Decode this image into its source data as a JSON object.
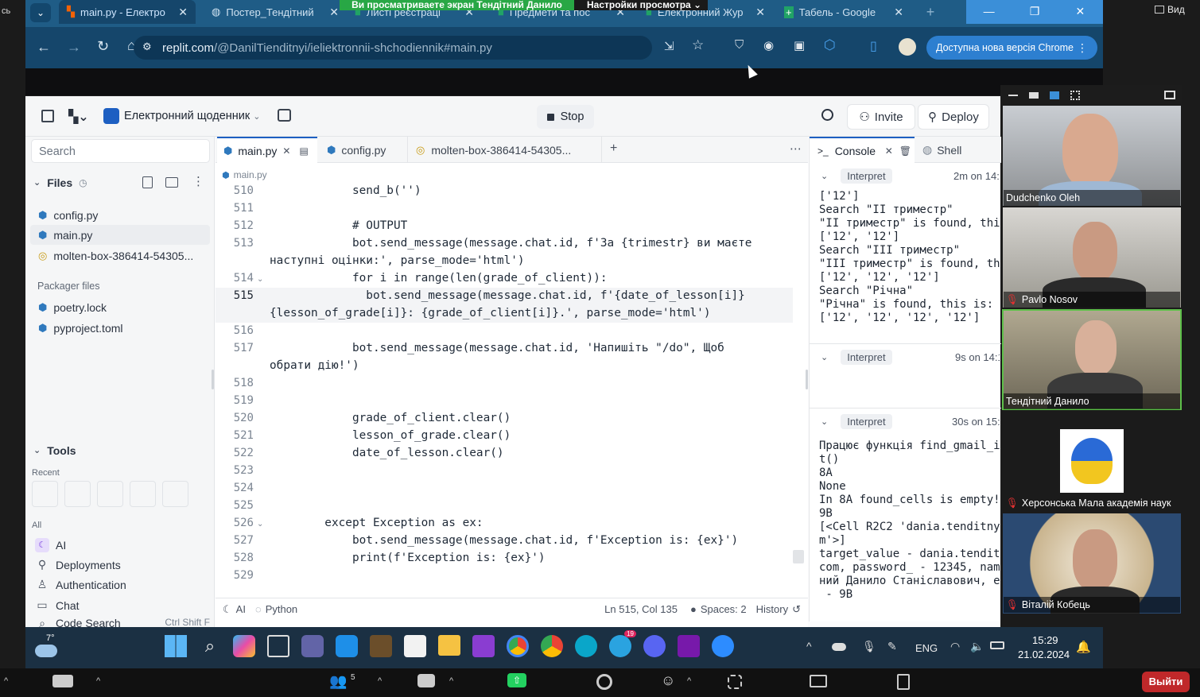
{
  "chrome": {
    "tabs": [
      {
        "label": "main.py - Електро"
      },
      {
        "label": "Постер_Тендітний"
      },
      {
        "label": "Листі реєстраці"
      },
      {
        "label": "Предмети та пос"
      },
      {
        "label": "Електронний Жур"
      },
      {
        "label": "Табель - Google "
      }
    ],
    "url_host": "replit.com",
    "url_path": "/@DanilTienditnyi/ieliektronnii-shchodiennik#main.py",
    "update_button": "Доступна нова версія Chrome",
    "share_banner": "Ви просматриваете экран Тендітний Данило",
    "view_settings": "Настройки просмотра"
  },
  "replit": {
    "project_name": "Електронний щоденник",
    "stop_label": "Stop",
    "invite_label": "Invite",
    "deploy_label": "Deploy",
    "search_placeholder": "Search",
    "files_header": "Files",
    "files": [
      "config.py",
      "main.py",
      "molten-box-386414-54305..."
    ],
    "packager_header": "Packager files",
    "packager_files": [
      "poetry.lock",
      "pyproject.toml"
    ],
    "tools_header": "Tools",
    "recent_label": "Recent",
    "all_label": "All",
    "tools": [
      "AI",
      "Deployments",
      "Authentication",
      "Chat",
      "Code Search"
    ],
    "tools_shortcut": "Ctrl Shift F",
    "editor_tabs": [
      "main.py",
      "config.py",
      "molten-box-386414-54305..."
    ],
    "breadcrumb": "main.py",
    "code_lines": [
      {
        "n": "510",
        "text": "            send_b('')"
      },
      {
        "n": "511",
        "text": ""
      },
      {
        "n": "512",
        "text": "            # OUTPUT"
      },
      {
        "n": "513",
        "text": "            bot.send_message(message.chat.id, f'За {trimestr} ви маєте"
      },
      {
        "n": "",
        "text": "наступні оцінки:', parse_mode='html')"
      },
      {
        "n": "514",
        "text": "            for i in range(len(grade_of_client)):"
      },
      {
        "n": "515",
        "text": "              bot.send_message(message.chat.id, f'{date_of_lesson[i]}"
      },
      {
        "n": "",
        "text": "{lesson_of_grade[i]}: {grade_of_client[i]}.', parse_mode='html')"
      },
      {
        "n": "516",
        "text": ""
      },
      {
        "n": "517",
        "text": "            bot.send_message(message.chat.id, 'Напишіть \"/do\", Щоб"
      },
      {
        "n": "",
        "text": "обрати дію!')"
      },
      {
        "n": "518",
        "text": ""
      },
      {
        "n": "519",
        "text": ""
      },
      {
        "n": "520",
        "text": "            grade_of_client.clear()"
      },
      {
        "n": "521",
        "text": "            lesson_of_grade.clear()"
      },
      {
        "n": "522",
        "text": "            date_of_lesson.clear()"
      },
      {
        "n": "523",
        "text": ""
      },
      {
        "n": "524",
        "text": ""
      },
      {
        "n": "525",
        "text": ""
      },
      {
        "n": "526",
        "text": "        except Exception as ex:"
      },
      {
        "n": "527",
        "text": "            bot.send_message(message.chat.id, f'Exception is: {ex}')"
      },
      {
        "n": "528",
        "text": "            print(f'Exception is: {ex}')"
      },
      {
        "n": "529",
        "text": ""
      }
    ],
    "status": {
      "ai": "AI",
      "language": "Python",
      "position": "Ln 515, Col 135",
      "spaces": "Spaces: 2",
      "history": "History"
    },
    "console": {
      "tab_console": "Console",
      "tab_shell": "Shell",
      "blocks": [
        {
          "label": "Interpret",
          "time": "2m on 14:1",
          "output": "['12']\nSearch \"II триместр\"\n\"II триместр\" is found, thi\n['12', '12']\nSearch \"III триместр\"\n\"III триместр\" is found, th\n['12', '12', '12']\nSearch \"Річна\"\n\"Річна\" is found, this is:\n['12', '12', '12', '12']"
        },
        {
          "label": "Interpret",
          "time": "9s on 14:1",
          "output": ""
        },
        {
          "label": "Interpret",
          "time": "30s on 15:2",
          "output": "Працює функція find_gmail_i\nt()\n8A\nNone\nIn 8A found_cells is empty!\n9B\n[<Cell R2C2 'dania.tenditny\nm'>]\ntarget_value - dania.tendit\ncom, password_ - 12345, nam\nний Данило Станіславович, e\n - 9B"
        }
      ]
    }
  },
  "participants": [
    {
      "name": "Dudchenko Oleh",
      "muted": false
    },
    {
      "name": "Pavlo Nosov",
      "muted": true
    },
    {
      "name": "Тендітний Данило",
      "muted": false
    },
    {
      "name": "Херсонська Мала академія наук",
      "muted": true
    },
    {
      "name": "Віталій Кобець",
      "muted": true
    }
  ],
  "taskbar": {
    "weather": "7°",
    "lang": "ENG",
    "time": "15:29",
    "date": "21.02.2024",
    "telegram_badge": "19"
  },
  "zoom": {
    "leave_label": "Выйти",
    "view_label": "Вид",
    "participants_count": "5",
    "left_label": "сь"
  },
  "colors": {
    "chrome_tabbar": "#1f5c86",
    "replit_accent": "#1d5fc2",
    "share_banner": "#28a745",
    "leave_button": "#c0282a"
  }
}
